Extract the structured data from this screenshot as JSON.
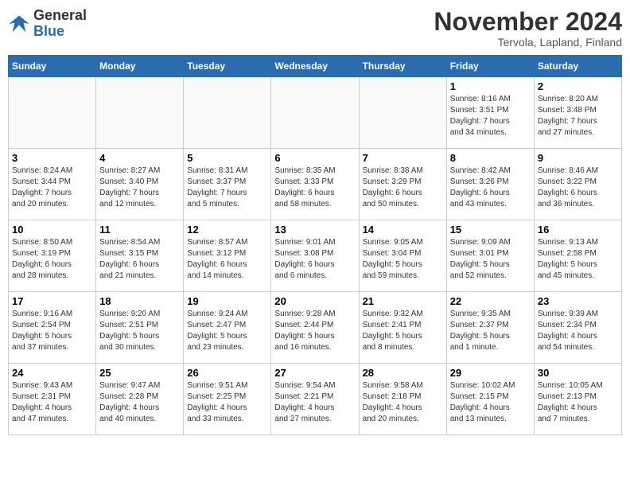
{
  "logo": {
    "general": "General",
    "blue": "Blue"
  },
  "title": "November 2024",
  "location": "Tervola, Lapland, Finland",
  "days_of_week": [
    "Sunday",
    "Monday",
    "Tuesday",
    "Wednesday",
    "Thursday",
    "Friday",
    "Saturday"
  ],
  "weeks": [
    [
      {
        "day": "",
        "info": ""
      },
      {
        "day": "",
        "info": ""
      },
      {
        "day": "",
        "info": ""
      },
      {
        "day": "",
        "info": ""
      },
      {
        "day": "",
        "info": ""
      },
      {
        "day": "1",
        "info": "Sunrise: 8:16 AM\nSunset: 3:51 PM\nDaylight: 7 hours\nand 34 minutes."
      },
      {
        "day": "2",
        "info": "Sunrise: 8:20 AM\nSunset: 3:48 PM\nDaylight: 7 hours\nand 27 minutes."
      }
    ],
    [
      {
        "day": "3",
        "info": "Sunrise: 8:24 AM\nSunset: 3:44 PM\nDaylight: 7 hours\nand 20 minutes."
      },
      {
        "day": "4",
        "info": "Sunrise: 8:27 AM\nSunset: 3:40 PM\nDaylight: 7 hours\nand 12 minutes."
      },
      {
        "day": "5",
        "info": "Sunrise: 8:31 AM\nSunset: 3:37 PM\nDaylight: 7 hours\nand 5 minutes."
      },
      {
        "day": "6",
        "info": "Sunrise: 8:35 AM\nSunset: 3:33 PM\nDaylight: 6 hours\nand 58 minutes."
      },
      {
        "day": "7",
        "info": "Sunrise: 8:38 AM\nSunset: 3:29 PM\nDaylight: 6 hours\nand 50 minutes."
      },
      {
        "day": "8",
        "info": "Sunrise: 8:42 AM\nSunset: 3:26 PM\nDaylight: 6 hours\nand 43 minutes."
      },
      {
        "day": "9",
        "info": "Sunrise: 8:46 AM\nSunset: 3:22 PM\nDaylight: 6 hours\nand 36 minutes."
      }
    ],
    [
      {
        "day": "10",
        "info": "Sunrise: 8:50 AM\nSunset: 3:19 PM\nDaylight: 6 hours\nand 28 minutes."
      },
      {
        "day": "11",
        "info": "Sunrise: 8:54 AM\nSunset: 3:15 PM\nDaylight: 6 hours\nand 21 minutes."
      },
      {
        "day": "12",
        "info": "Sunrise: 8:57 AM\nSunset: 3:12 PM\nDaylight: 6 hours\nand 14 minutes."
      },
      {
        "day": "13",
        "info": "Sunrise: 9:01 AM\nSunset: 3:08 PM\nDaylight: 6 hours\nand 6 minutes."
      },
      {
        "day": "14",
        "info": "Sunrise: 9:05 AM\nSunset: 3:04 PM\nDaylight: 5 hours\nand 59 minutes."
      },
      {
        "day": "15",
        "info": "Sunrise: 9:09 AM\nSunset: 3:01 PM\nDaylight: 5 hours\nand 52 minutes."
      },
      {
        "day": "16",
        "info": "Sunrise: 9:13 AM\nSunset: 2:58 PM\nDaylight: 5 hours\nand 45 minutes."
      }
    ],
    [
      {
        "day": "17",
        "info": "Sunrise: 9:16 AM\nSunset: 2:54 PM\nDaylight: 5 hours\nand 37 minutes."
      },
      {
        "day": "18",
        "info": "Sunrise: 9:20 AM\nSunset: 2:51 PM\nDaylight: 5 hours\nand 30 minutes."
      },
      {
        "day": "19",
        "info": "Sunrise: 9:24 AM\nSunset: 2:47 PM\nDaylight: 5 hours\nand 23 minutes."
      },
      {
        "day": "20",
        "info": "Sunrise: 9:28 AM\nSunset: 2:44 PM\nDaylight: 5 hours\nand 16 minutes."
      },
      {
        "day": "21",
        "info": "Sunrise: 9:32 AM\nSunset: 2:41 PM\nDaylight: 5 hours\nand 8 minutes."
      },
      {
        "day": "22",
        "info": "Sunrise: 9:35 AM\nSunset: 2:37 PM\nDaylight: 5 hours\nand 1 minute."
      },
      {
        "day": "23",
        "info": "Sunrise: 9:39 AM\nSunset: 2:34 PM\nDaylight: 4 hours\nand 54 minutes."
      }
    ],
    [
      {
        "day": "24",
        "info": "Sunrise: 9:43 AM\nSunset: 2:31 PM\nDaylight: 4 hours\nand 47 minutes."
      },
      {
        "day": "25",
        "info": "Sunrise: 9:47 AM\nSunset: 2:28 PM\nDaylight: 4 hours\nand 40 minutes."
      },
      {
        "day": "26",
        "info": "Sunrise: 9:51 AM\nSunset: 2:25 PM\nDaylight: 4 hours\nand 33 minutes."
      },
      {
        "day": "27",
        "info": "Sunrise: 9:54 AM\nSunset: 2:21 PM\nDaylight: 4 hours\nand 27 minutes."
      },
      {
        "day": "28",
        "info": "Sunrise: 9:58 AM\nSunset: 2:18 PM\nDaylight: 4 hours\nand 20 minutes."
      },
      {
        "day": "29",
        "info": "Sunrise: 10:02 AM\nSunset: 2:15 PM\nDaylight: 4 hours\nand 13 minutes."
      },
      {
        "day": "30",
        "info": "Sunrise: 10:05 AM\nSunset: 2:13 PM\nDaylight: 4 hours\nand 7 minutes."
      }
    ]
  ]
}
